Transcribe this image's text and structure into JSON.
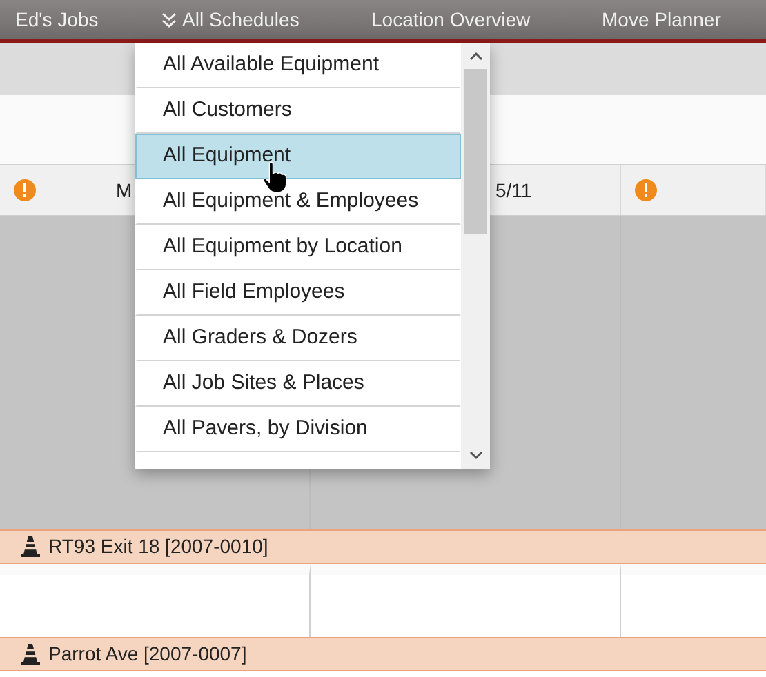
{
  "nav": {
    "items": [
      {
        "label": "Ed's Jobs",
        "has_menu": false
      },
      {
        "label": "All Schedules",
        "has_menu": true
      },
      {
        "label": "Location Overview",
        "has_menu": false
      },
      {
        "label": "Move Planner",
        "has_menu": false
      }
    ]
  },
  "schedule_menu": {
    "items": [
      {
        "label": "All Available Equipment",
        "selected": false
      },
      {
        "label": "All Customers",
        "selected": false
      },
      {
        "label": "All Equipment",
        "selected": true
      },
      {
        "label": "All Equipment & Employees",
        "selected": false
      },
      {
        "label": "All Equipment by Location",
        "selected": false
      },
      {
        "label": "All Field Employees",
        "selected": false
      },
      {
        "label": "All Graders & Dozers",
        "selected": false
      },
      {
        "label": "All Job Sites & Places",
        "selected": false
      },
      {
        "label": "All Pavers, by Division",
        "selected": false
      }
    ]
  },
  "day_header": {
    "cells": [
      {
        "alert": true,
        "text": "M"
      },
      {
        "alert": false,
        "text": "5/11"
      },
      {
        "alert": true
      }
    ]
  },
  "job_groups": [
    {
      "label": "RT93 Exit 18 [2007-0010]"
    },
    {
      "label": "Parrot Ave [2007-0007]"
    }
  ]
}
